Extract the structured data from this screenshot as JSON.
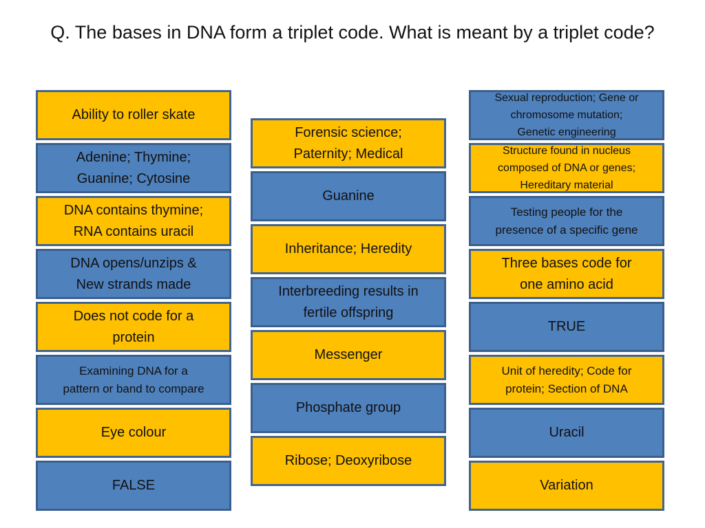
{
  "title": "Q. The bases in DNA form a triplet code. What is meant by a triplet code?",
  "colors": {
    "yellow": "#ffc000",
    "blue": "#4f81bd",
    "border": "#3f6591"
  },
  "columns": {
    "left": [
      {
        "text": "Ability to roller skate",
        "color": "yellow"
      },
      {
        "text": "Adenine; Thymine;\nGuanine; Cytosine",
        "color": "blue"
      },
      {
        "text": "DNA contains thymine;\nRNA contains uracil",
        "color": "yellow"
      },
      {
        "text": "DNA opens/unzips &\nNew strands made",
        "color": "blue"
      },
      {
        "text": "Does not code for a\nprotein",
        "color": "yellow"
      },
      {
        "text": "Examining DNA for a\npattern or band to compare",
        "color": "blue"
      },
      {
        "text": "Eye colour",
        "color": "yellow"
      },
      {
        "text": "FALSE",
        "color": "blue"
      }
    ],
    "middle": [
      {
        "text": "Forensic science;\nPaternity; Medical",
        "color": "yellow"
      },
      {
        "text": "Guanine",
        "color": "blue"
      },
      {
        "text": "Inheritance; Heredity",
        "color": "yellow"
      },
      {
        "text": "Interbreeding results in\nfertile offspring",
        "color": "blue"
      },
      {
        "text": "Messenger",
        "color": "yellow"
      },
      {
        "text": "Phosphate group",
        "color": "blue"
      },
      {
        "text": "Ribose; Deoxyribose",
        "color": "yellow"
      }
    ],
    "right": [
      {
        "text": "Sexual reproduction; Gene or\nchromosome mutation;\nGenetic engineering",
        "color": "blue"
      },
      {
        "text": "Structure found in nucleus\ncomposed of DNA or genes;\nHereditary material",
        "color": "yellow"
      },
      {
        "text": "Testing people for the\npresence of a specific gene",
        "color": "blue"
      },
      {
        "text": "Three bases code for\none amino acid",
        "color": "yellow"
      },
      {
        "text": "TRUE",
        "color": "blue"
      },
      {
        "text": "Unit of heredity; Code for\nprotein; Section of DNA",
        "color": "yellow"
      },
      {
        "text": "Uracil",
        "color": "blue"
      },
      {
        "text": "Variation",
        "color": "yellow"
      }
    ]
  }
}
